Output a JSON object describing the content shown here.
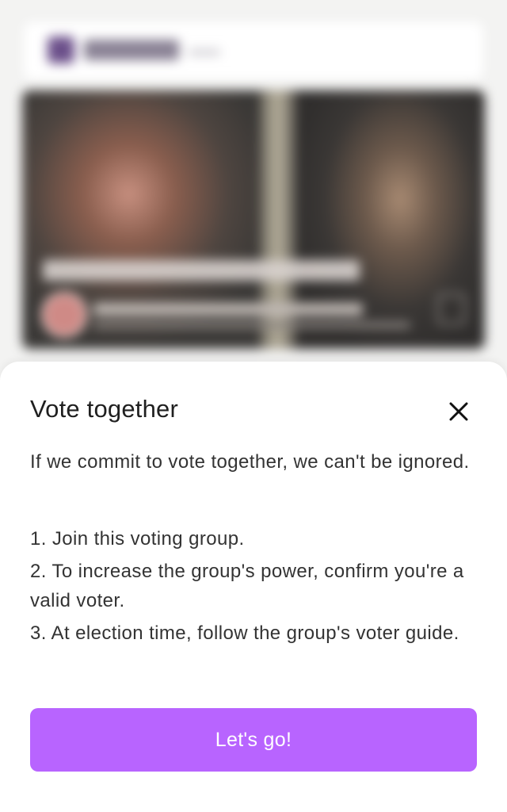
{
  "background": {
    "blurred": true,
    "icons": [
      "logo-icon",
      "avatar",
      "bookmark-icon"
    ]
  },
  "sheet": {
    "title": "Vote together",
    "close_icon": "close-icon",
    "intro": "If we commit to vote together, we can't be ignored.",
    "steps": [
      "1. Join this voting group.",
      "2. To increase the group's power, confirm you're a valid voter.",
      "3. At election time, follow the group's voter guide."
    ],
    "cta_label": "Let's go!"
  },
  "colors": {
    "accent": "#b864ff",
    "sheet_background": "#ffffff",
    "page_background": "#f3f3f2",
    "text": "#333333"
  }
}
